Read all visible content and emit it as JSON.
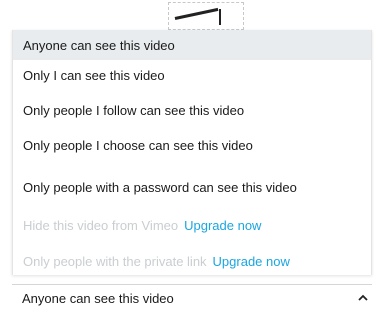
{
  "menu": {
    "options": [
      {
        "label": "Anyone can see this video",
        "state": "selected"
      },
      {
        "label": "Only I can see this video",
        "state": "enabled"
      },
      {
        "label": "Only people I follow can see this video",
        "state": "enabled"
      },
      {
        "label": "Only people I choose can see this video",
        "state": "enabled"
      },
      {
        "label": "Only people with a password can see this video",
        "state": "enabled"
      },
      {
        "label": "Hide this video from Vimeo",
        "state": "disabled",
        "upgrade_label": "Upgrade now"
      },
      {
        "label": "Only people with the private link",
        "state": "disabled",
        "upgrade_label": "Upgrade now"
      }
    ]
  },
  "select": {
    "value": "Anyone can see this video",
    "icon": "chevron-up-icon"
  },
  "colors": {
    "selected_bg": "#e8ecee",
    "disabled_text": "#c9ced1",
    "link": "#1aa6e0"
  }
}
